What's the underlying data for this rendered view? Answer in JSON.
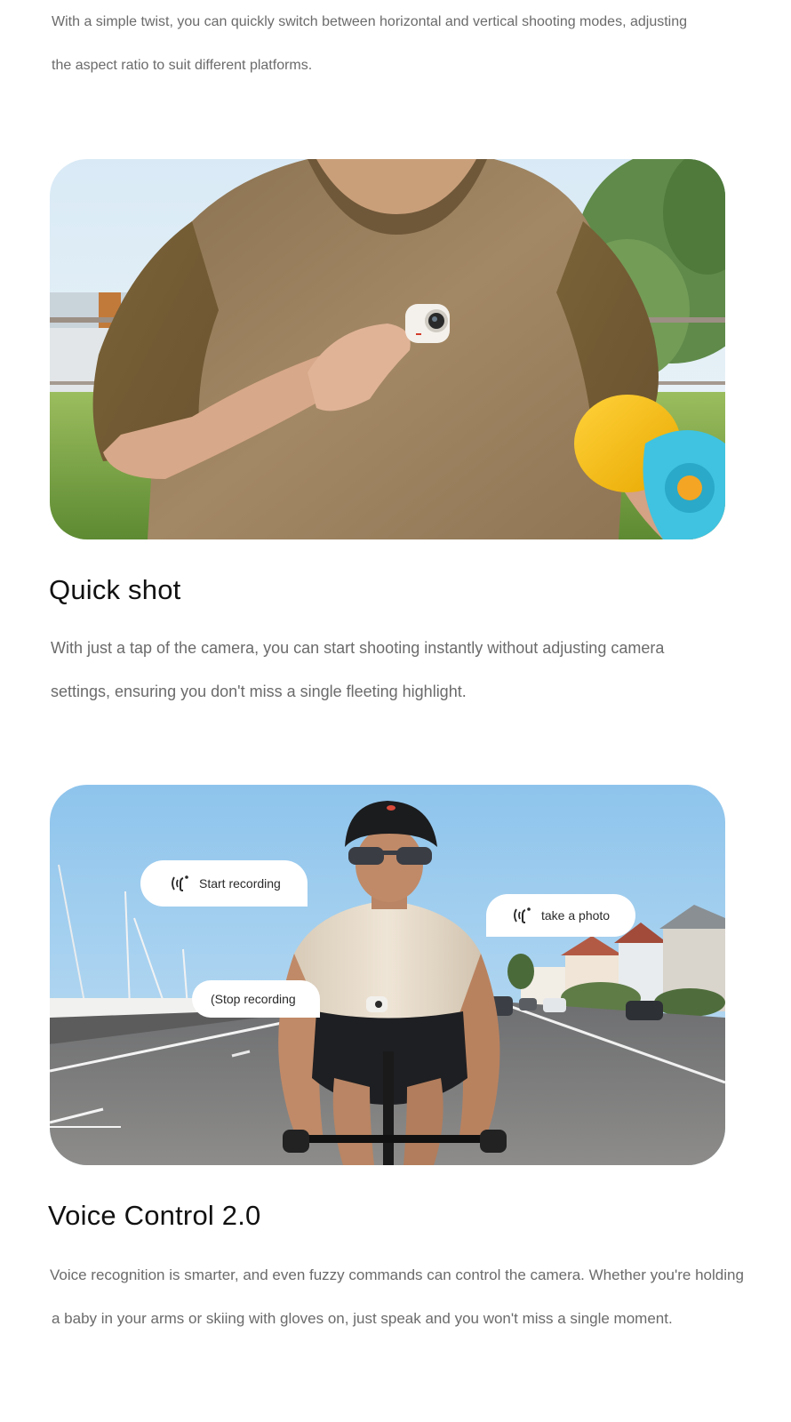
{
  "intro": {
    "lines": [
      "With a simple twist, you can quickly switch between horizontal and vertical shooting modes, adjusting",
      "the aspect ratio to suit different platforms."
    ]
  },
  "quick_shot": {
    "title": "Quick shot",
    "lines": [
      "With just a tap of the camera, you can start shooting instantly without adjusting camera",
      "settings, ensuring you don't miss a single fleeting highlight."
    ]
  },
  "voice_control": {
    "title": "Voice Control 2.0",
    "bubbles": {
      "start": "Start recording",
      "photo": "take a photo",
      "stop": "(Stop recording"
    },
    "lines": [
      "Voice recognition is smarter, and even fuzzy commands can control the camera. Whether you're holding",
      "a baby in your arms or skiing with gloves on, just speak and you won't miss a single moment."
    ]
  },
  "icons": {
    "voice": "voice-wave-icon"
  }
}
